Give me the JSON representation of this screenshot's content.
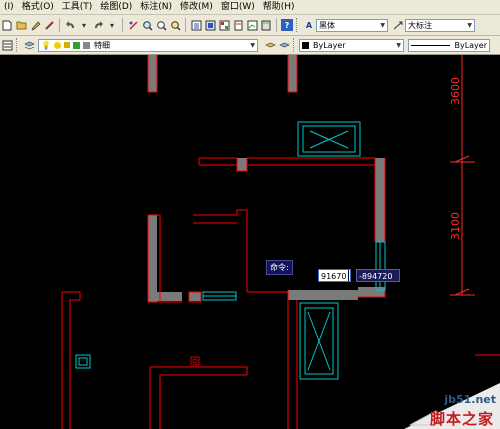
{
  "menu": [
    "(I)",
    "格式(O)",
    "工具(T)",
    "绘图(D)",
    "标注(N)",
    "修改(M)",
    "窗口(W)",
    "帮助(H)"
  ],
  "toolbar1": {
    "font_combo": "黑体",
    "style_combo": "大标注"
  },
  "toolbar2": {
    "layer_combo": "特细",
    "color_combo": "ByLayer",
    "linetype_combo": "ByLayer"
  },
  "dimensions": {
    "upper": "3600",
    "lower": "3100"
  },
  "command": {
    "label": "命令:",
    "x_value": "91670",
    "y_value": "-894720"
  },
  "watermark": {
    "site": "jb51.net",
    "brand": "脚本之家"
  },
  "colors": {
    "wall_fill": "#7a7a7a",
    "wall_edge": "#ff0000",
    "window": "#00c8c8",
    "dim_red": "#ff2a2a"
  }
}
